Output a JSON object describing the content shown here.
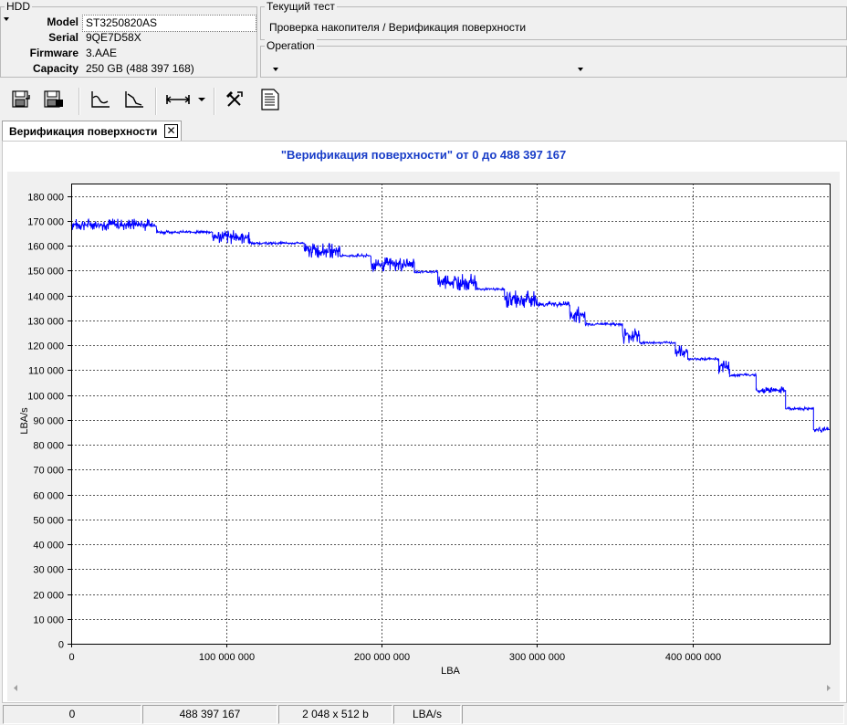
{
  "hdd": {
    "title": "HDD",
    "model_label": "Model",
    "model_value": "ST3250820AS",
    "serial_label": "Serial",
    "serial_value": "9QE7D58X",
    "firmware_label": "Firmware",
    "firmware_value": "3.AAE",
    "capacity_label": "Capacity",
    "capacity_value": "250 GB (488 397 168)"
  },
  "current_test": {
    "title": "Текущий тест",
    "value": "Проверка накопителя / Верификация поверхности"
  },
  "operation": {
    "title": "Operation",
    "value": ""
  },
  "toolbar": {
    "icons": [
      "save-icon",
      "save-as-icon",
      "graph-icon",
      "graph-down-icon",
      "range-icon",
      "dropdown-icon",
      "tools-icon",
      "report-icon"
    ]
  },
  "tab": {
    "label": "Верификация поверхности",
    "close": "✕"
  },
  "chart_title": "\"Верификация поверхности\" от 0 до 488 397 167",
  "chart_data": {
    "type": "line",
    "title": "\"Верификация поверхности\" от 0 до 488 397 167",
    "xlabel": "LBA",
    "ylabel": "LBA/s",
    "xlim": [
      0,
      488397167
    ],
    "ylim": [
      0,
      185000
    ],
    "x_ticks": [
      0,
      100000000,
      200000000,
      300000000,
      400000000
    ],
    "x_tick_labels": [
      "0",
      "100 000 000",
      "200 000 000",
      "300 000 000",
      "400 000 000"
    ],
    "y_ticks": [
      0,
      10000,
      20000,
      30000,
      40000,
      50000,
      60000,
      70000,
      80000,
      90000,
      100000,
      110000,
      120000,
      130000,
      140000,
      150000,
      160000,
      170000,
      180000
    ],
    "y_tick_labels": [
      "0",
      "10 000",
      "20 000",
      "30 000",
      "40 000",
      "50 000",
      "60 000",
      "70 000",
      "80 000",
      "90 000",
      "100 000",
      "110 000",
      "120 000",
      "130 000",
      "140 000",
      "150 000",
      "160 000",
      "170 000",
      "180 000"
    ],
    "grid": true,
    "color": "#0000ff",
    "series": [
      {
        "segments": [
          {
            "x0": 0,
            "x1": 55000000,
            "y": 168500,
            "noise": 2500
          },
          {
            "x0": 55000000,
            "x1": 91000000,
            "y": 165500,
            "noise": 600
          },
          {
            "x0": 91000000,
            "x1": 115000000,
            "y": 163500,
            "noise": 3000
          },
          {
            "x0": 115000000,
            "x1": 150000000,
            "y": 161000,
            "noise": 500
          },
          {
            "x0": 150000000,
            "x1": 173000000,
            "y": 158000,
            "noise": 3000
          },
          {
            "x0": 173000000,
            "x1": 193000000,
            "y": 156000,
            "noise": 600
          },
          {
            "x0": 193000000,
            "x1": 221000000,
            "y": 152500,
            "noise": 3000
          },
          {
            "x0": 221000000,
            "x1": 236000000,
            "y": 149500,
            "noise": 500
          },
          {
            "x0": 236000000,
            "x1": 261000000,
            "y": 145500,
            "noise": 3500
          },
          {
            "x0": 261000000,
            "x1": 279000000,
            "y": 142500,
            "noise": 500
          },
          {
            "x0": 279000000,
            "x1": 300000000,
            "y": 138500,
            "noise": 3500
          },
          {
            "x0": 300000000,
            "x1": 321000000,
            "y": 136500,
            "noise": 1200
          },
          {
            "x0": 321000000,
            "x1": 331000000,
            "y": 132000,
            "noise": 4000
          },
          {
            "x0": 331000000,
            "x1": 355000000,
            "y": 128500,
            "noise": 600
          },
          {
            "x0": 355000000,
            "x1": 366000000,
            "y": 124000,
            "noise": 3500
          },
          {
            "x0": 366000000,
            "x1": 389000000,
            "y": 121000,
            "noise": 500
          },
          {
            "x0": 389000000,
            "x1": 397000000,
            "y": 117500,
            "noise": 2500
          },
          {
            "x0": 397000000,
            "x1": 417000000,
            "y": 114500,
            "noise": 500
          },
          {
            "x0": 417000000,
            "x1": 424000000,
            "y": 111000,
            "noise": 3000
          },
          {
            "x0": 424000000,
            "x1": 441000000,
            "y": 108000,
            "noise": 600
          },
          {
            "x0": 441000000,
            "x1": 460000000,
            "y": 102000,
            "noise": 1200
          },
          {
            "x0": 460000000,
            "x1": 478000000,
            "y": 94500,
            "noise": 700
          },
          {
            "x0": 478000000,
            "x1": 488397167,
            "y": 86000,
            "noise": 1000
          }
        ]
      }
    ]
  },
  "status": {
    "start": "0",
    "end": "488 397 167",
    "block": "2 048 x 512 b",
    "units": "LBA/s"
  }
}
